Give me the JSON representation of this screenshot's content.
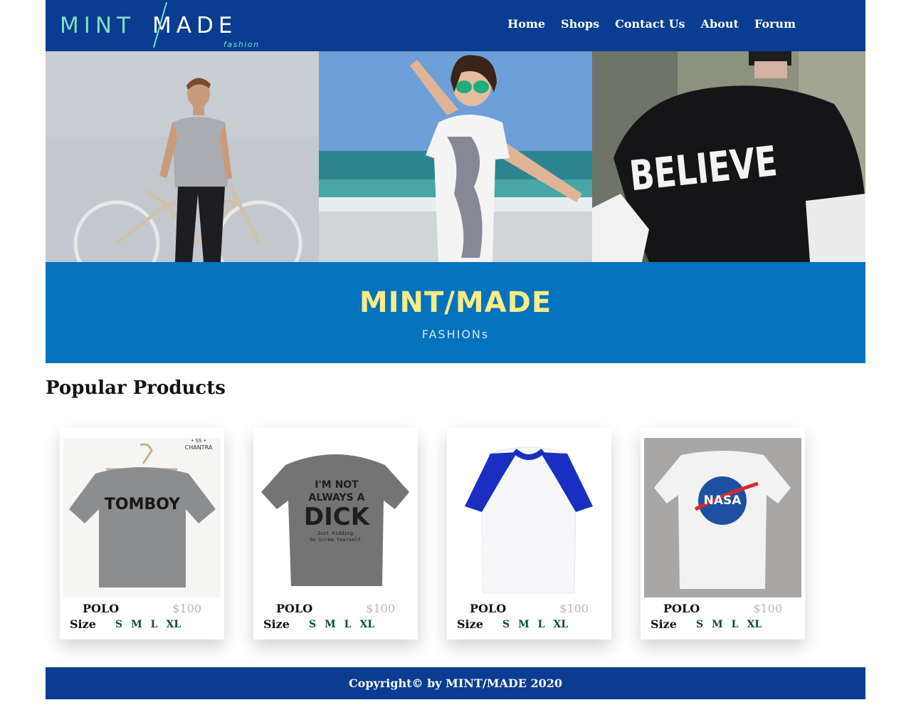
{
  "header": {
    "logo_left": "MINT",
    "logo_right": "MADE",
    "logo_sub": "fashion",
    "nav": [
      "Home",
      "Shops",
      "Contact Us",
      "About",
      "Forum"
    ]
  },
  "hero": {
    "shirt_text": "BELIEVE"
  },
  "banner": {
    "title": "MINT/MADE",
    "subtitle": "FASHIONs"
  },
  "section": {
    "title": "Popular Products"
  },
  "products": [
    {
      "name": "POLO",
      "price": "$100",
      "size_label": "Size",
      "sizes": [
        "S",
        "M",
        "L",
        "XL"
      ],
      "print_text": "TOMBOY",
      "brand_tag": "• SS •\nCHANTRA"
    },
    {
      "name": "POLO",
      "price": "$100",
      "size_label": "Size",
      "sizes": [
        "S",
        "M",
        "L",
        "XL"
      ],
      "print_line1": "I'M NOT",
      "print_line2": "ALWAYS A",
      "print_line3": "DICK",
      "print_line4": "Just Kidding.",
      "print_line5": "Go Screw Yourself."
    },
    {
      "name": "POLO",
      "price": "$100",
      "size_label": "Size",
      "sizes": [
        "S",
        "M",
        "L",
        "XL"
      ]
    },
    {
      "name": "POLO",
      "price": "$100",
      "size_label": "Size",
      "sizes": [
        "S",
        "M",
        "L",
        "XL"
      ],
      "print_text": "NASA"
    }
  ],
  "footer": {
    "copyright": "Copyright© by MINT/MADE 2020"
  },
  "colors": {
    "header_bg": "#0a3d91",
    "banner_bg": "#0473bd",
    "logo_mint": "#7ee0c2",
    "banner_title": "#f6ec88",
    "size_link": "#0b4d3a",
    "price_gray": "#b7b7b7"
  }
}
